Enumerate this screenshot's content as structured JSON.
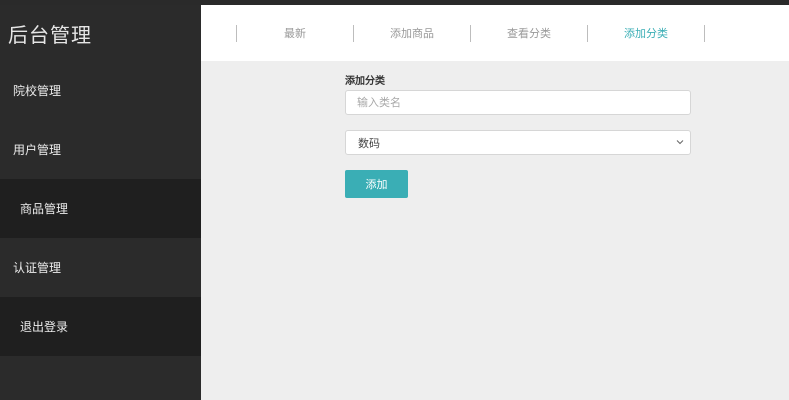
{
  "sidebar": {
    "brand": "后台管理",
    "items": [
      {
        "label": "院校管理"
      },
      {
        "label": "用户管理"
      },
      {
        "label": "商品管理"
      },
      {
        "label": "认证管理"
      },
      {
        "label": "退出登录"
      }
    ]
  },
  "tabs": [
    {
      "label": "最新"
    },
    {
      "label": "添加商品"
    },
    {
      "label": "查看分类"
    },
    {
      "label": "添加分类",
      "active": true
    }
  ],
  "form": {
    "title": "添加分类",
    "name_placeholder": "输入类名",
    "category_selected": "数码",
    "submit_label": "添加"
  },
  "colors": {
    "accent": "#3aaeb5",
    "sidebar_bg": "#2b2b2b",
    "sidebar_dark_item": "#1f1f1f",
    "content_bg": "#eeeeee"
  },
  "icons": {
    "select_arrow": "chevron-down-icon"
  }
}
